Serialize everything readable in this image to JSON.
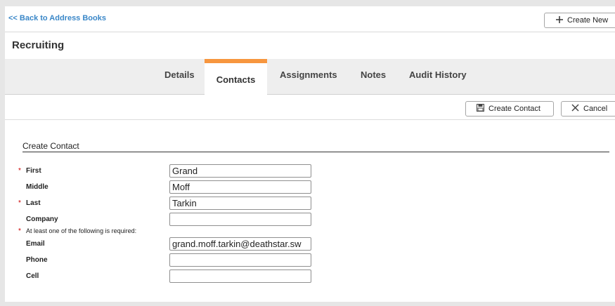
{
  "nav": {
    "back_label": "<< Back to Address Books"
  },
  "header": {
    "create_new_label": "Create New",
    "title": "Recruiting"
  },
  "tabs": [
    {
      "label": "Details"
    },
    {
      "label": "Contacts",
      "active": true
    },
    {
      "label": "Assignments"
    },
    {
      "label": "Notes"
    },
    {
      "label": "Audit History"
    }
  ],
  "toolbar": {
    "create_contact_label": "Create Contact",
    "cancel_label": "Cancel"
  },
  "form": {
    "section_title": "Create Contact",
    "required_mark": "*",
    "fields": {
      "first": {
        "label": "First",
        "value": "Grand",
        "required": true
      },
      "middle": {
        "label": "Middle",
        "value": "Moff"
      },
      "last": {
        "label": "Last",
        "value": "Tarkin",
        "required": true
      },
      "company": {
        "label": "Company",
        "value": ""
      },
      "email": {
        "label": "Email",
        "value": "grand.moff.tarkin@deathstar.sw"
      },
      "phone": {
        "label": "Phone",
        "value": ""
      },
      "cell": {
        "label": "Cell",
        "value": ""
      }
    },
    "note": "At least one of the following is required:"
  },
  "colors": {
    "accent": "#f7963f",
    "link": "#3a87c8",
    "required": "#cc0000"
  },
  "icons": {
    "create_new": "plus-icon",
    "create_contact": "save-icon",
    "cancel": "close-icon"
  }
}
